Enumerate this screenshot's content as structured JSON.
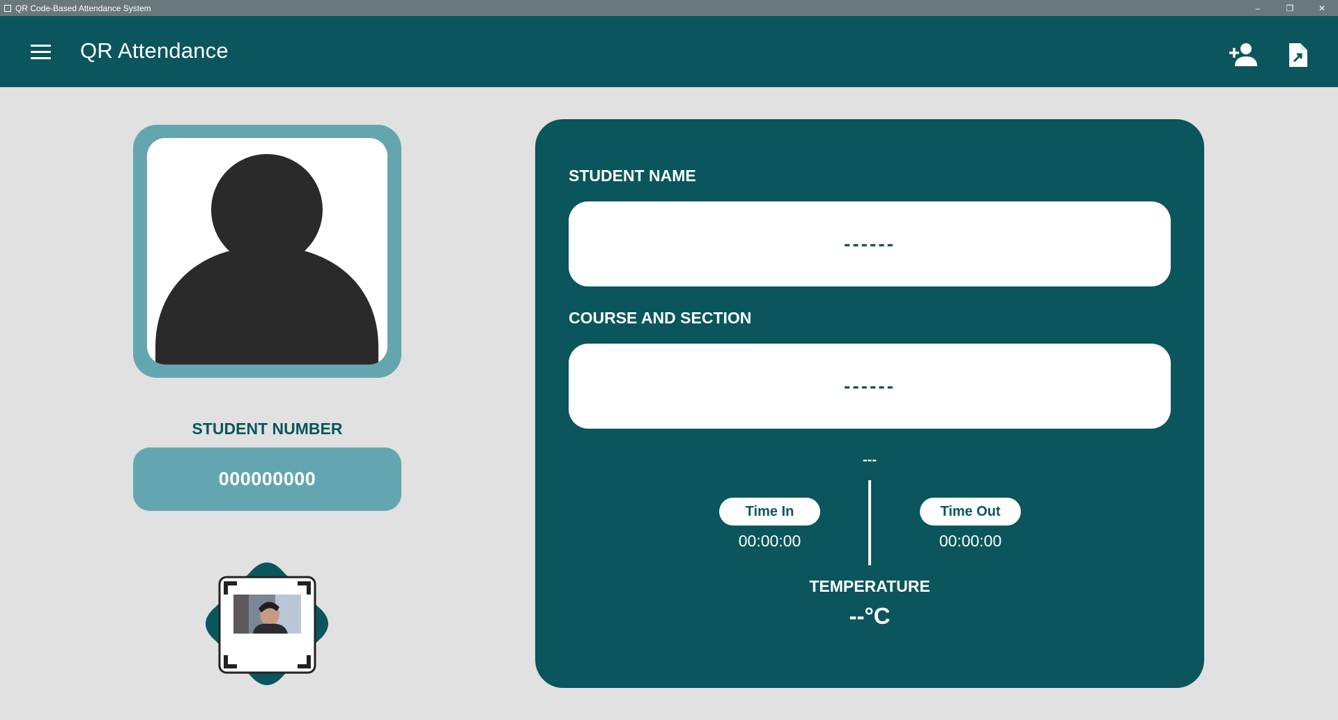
{
  "window": {
    "title": "QR Code-Based Attendance System",
    "minimize": "–",
    "restore": "❐",
    "close": "✕"
  },
  "appbar": {
    "title": "QR Attendance",
    "menu_icon": "hamburger-menu-icon",
    "actions": [
      "add-user-icon",
      "export-file-icon"
    ]
  },
  "student": {
    "number_label": "STUDENT NUMBER",
    "number_value": "000000000",
    "name_label": "STUDENT NAME",
    "name_value": "------",
    "course_label": "COURSE AND SECTION",
    "course_value": "------"
  },
  "attendance": {
    "status": "---",
    "time_in_label": "Time In",
    "time_in_value": "00:00:00",
    "time_out_label": "Time Out",
    "time_out_value": "00:00:00",
    "temperature_label": "TEMPERATURE",
    "temperature_value": "--°C"
  },
  "colors": {
    "primary": "#0a565c",
    "accent": "#64a6b0",
    "background": "#e1e1e1"
  }
}
